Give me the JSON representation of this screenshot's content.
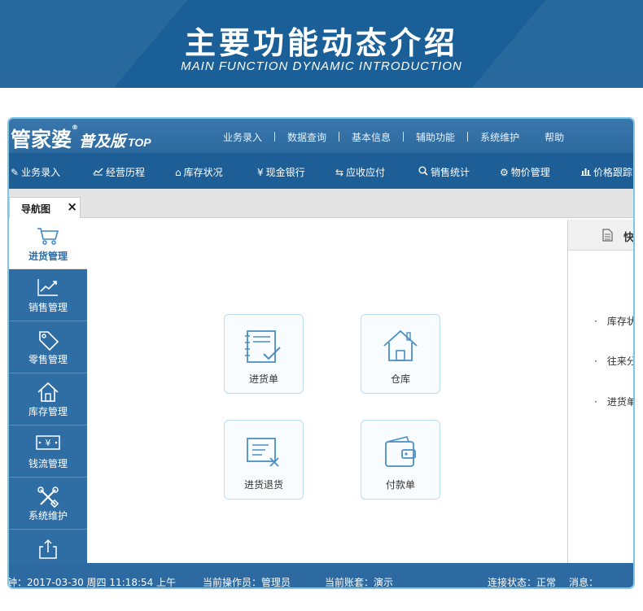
{
  "banner": {
    "title": "主要功能动态介绍",
    "subtitle": "MAIN FUNCTION DYNAMIC INTRODUCTION"
  },
  "app": {
    "logo": {
      "name": "管家婆",
      "edition": "普及版",
      "top": "TOP",
      "reg": "®"
    },
    "top_menu": [
      "业务录入",
      "数据查询",
      "基本信息",
      "辅助功能",
      "系统维护",
      "帮助"
    ],
    "toolbar": [
      {
        "label": "业务录入",
        "icon": "edit-icon"
      },
      {
        "label": "经营历程",
        "icon": "trend-icon"
      },
      {
        "label": "库存状况",
        "icon": "home-icon"
      },
      {
        "label": "现金银行",
        "icon": "yen-icon"
      },
      {
        "label": "应收应付",
        "icon": "exchange-icon"
      },
      {
        "label": "销售统计",
        "icon": "search-icon"
      },
      {
        "label": "物价管理",
        "icon": "gear-icon"
      },
      {
        "label": "价格跟踪",
        "icon": "bar-chart-icon"
      }
    ],
    "tab": {
      "label": "导航图",
      "close": "×"
    },
    "sidebar": [
      {
        "label": "进货管理",
        "icon": "cart-icon",
        "active": true
      },
      {
        "label": "销售管理",
        "icon": "trend-icon"
      },
      {
        "label": "零售管理",
        "icon": "tag-icon"
      },
      {
        "label": "库存管理",
        "icon": "house-icon"
      },
      {
        "label": "钱流管理",
        "icon": "banknote-icon",
        "glyph": "¥"
      },
      {
        "label": "系统维护",
        "icon": "tools-icon"
      },
      {
        "label": "",
        "icon": "export-icon"
      }
    ],
    "tiles": [
      {
        "label": "进货单",
        "icon": "purchase-order-icon"
      },
      {
        "label": "仓库",
        "icon": "warehouse-icon"
      },
      {
        "label": "进货退货",
        "icon": "purchase-return-icon"
      },
      {
        "label": "付款单",
        "icon": "wallet-icon"
      }
    ],
    "right_panel": {
      "title": "快",
      "items": [
        "库存状",
        "往来分",
        "进货单"
      ],
      "bullet": "·"
    },
    "status": {
      "clock": "钟：2017-03-30 周四 11:18:54 上午",
      "operator": "当前操作员：管理员",
      "account": "当前账套：演示",
      "connection": "连接状态：正常",
      "message": "消息："
    },
    "colors": {
      "banner": "#1a5f97",
      "toolbar": "#1e5e96",
      "sidebar": "#2f6ea5",
      "tile_border": "#bddcef",
      "icon_blue": "#4a8fc4"
    }
  }
}
